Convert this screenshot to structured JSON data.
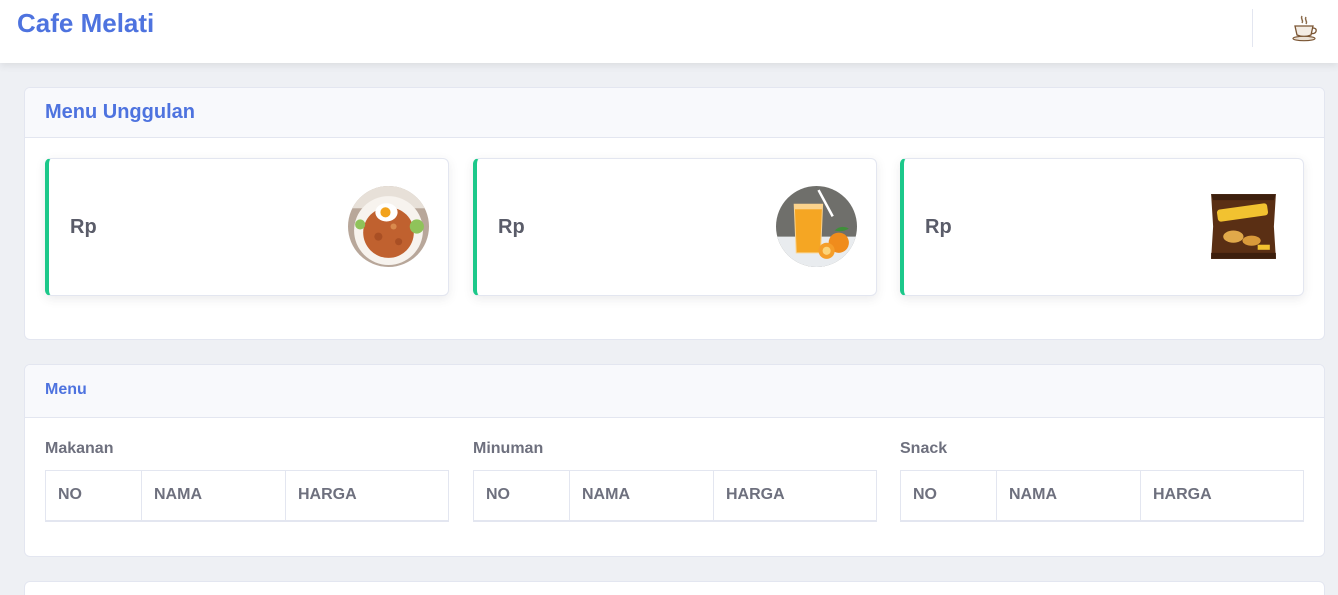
{
  "app": {
    "title": "Cafe Melati",
    "icon": "coffee-cup-icon"
  },
  "featured": {
    "title": "Menu Unggulan",
    "items": [
      {
        "price_label": "Rp",
        "image": "fried-rice-plate-image"
      },
      {
        "price_label": "Rp",
        "image": "orange-juice-glass-image"
      },
      {
        "price_label": "Rp",
        "image": "chitato-snack-pack-image"
      }
    ]
  },
  "menu": {
    "title": "Menu",
    "categories": [
      {
        "name": "Makanan",
        "columns": [
          "NO",
          "NAMA",
          "HARGA"
        ]
      },
      {
        "name": "Minuman",
        "columns": [
          "NO",
          "NAMA",
          "HARGA"
        ]
      },
      {
        "name": "Snack",
        "columns": [
          "NO",
          "NAMA",
          "HARGA"
        ]
      }
    ]
  },
  "colors": {
    "primary": "#4e73df",
    "success": "#1cc88a",
    "text": "#5a5c69",
    "background": "#eef0f4"
  }
}
